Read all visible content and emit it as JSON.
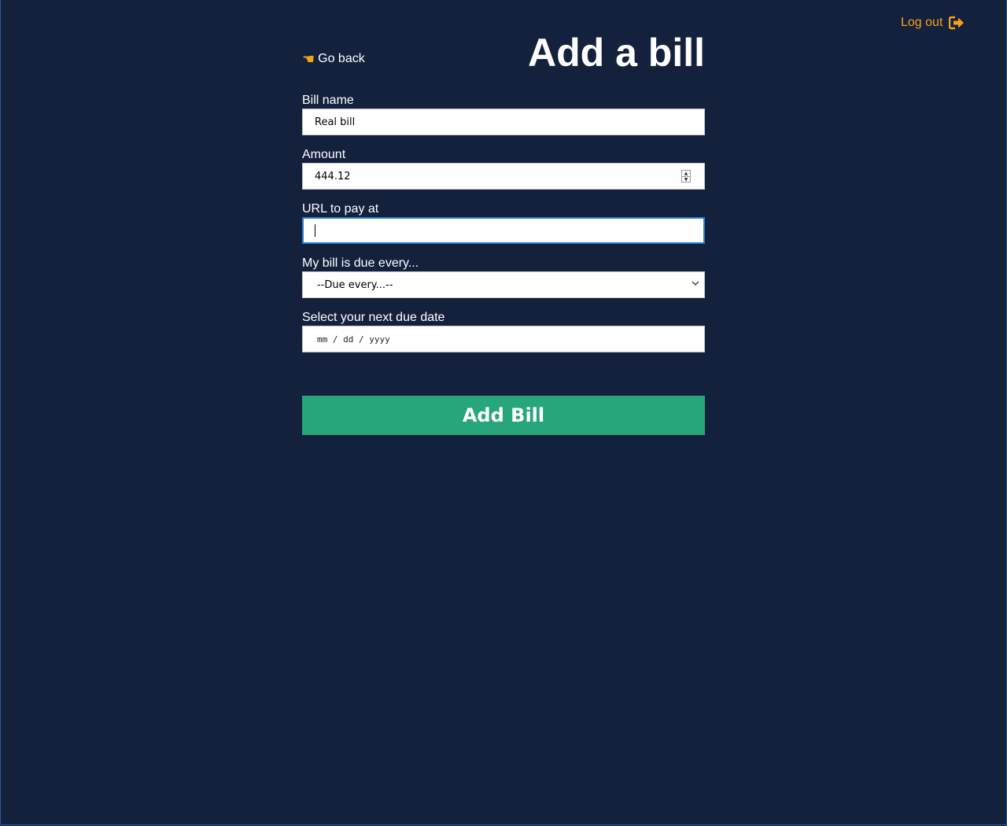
{
  "header": {
    "logout_label": "Log out",
    "go_back_label": "Go back",
    "title": "Add a bill"
  },
  "form": {
    "bill_name": {
      "label": "Bill name",
      "value": "Real bill"
    },
    "amount": {
      "label": "Amount",
      "value": "444.12"
    },
    "url": {
      "label": "URL to pay at",
      "value": ""
    },
    "frequency": {
      "label": "My bill is due every...",
      "selected": "--Due every...--"
    },
    "due_date": {
      "label": "Select your next due date",
      "placeholder": "mm / dd / yyyy"
    },
    "submit_label": "Add Bill"
  },
  "icons": {
    "logout": "logout-arrow-icon",
    "go_back": "pointing-hand-icon",
    "amount_stepper": "spinner-arrows-icon",
    "select_chevron": "chevron-down-icon"
  },
  "colors": {
    "background": "#13213d",
    "accent_orange": "#f5a21b",
    "button_green": "#27a57b",
    "focus_border": "#2b7fc9"
  }
}
